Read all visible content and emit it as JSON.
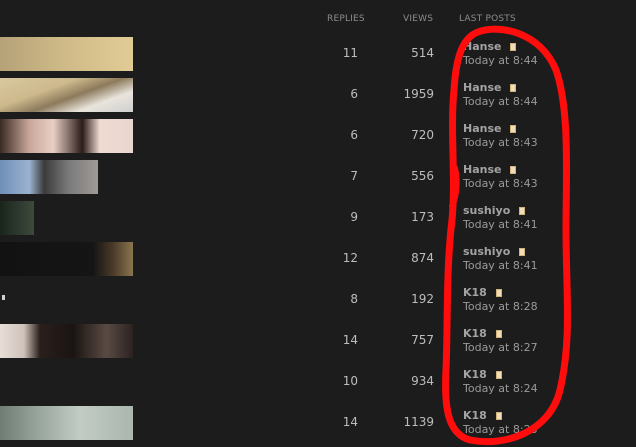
{
  "columns": {
    "replies": "REPLIES",
    "views": "VIEWS",
    "last_posts": "LAST POSTS"
  },
  "threads": [
    {
      "replies": "11",
      "views": "514",
      "user": "Hanse",
      "time": "Today at 8:44"
    },
    {
      "replies": "6",
      "views": "1959",
      "user": "Hanse",
      "time": "Today at 8:44"
    },
    {
      "replies": "6",
      "views": "720",
      "user": "Hanse",
      "time": "Today at 8:43"
    },
    {
      "replies": "7",
      "views": "556",
      "user": "Hanse",
      "time": "Today at 8:43"
    },
    {
      "replies": "9",
      "views": "173",
      "user": "sushiyo",
      "time": "Today at 8:41"
    },
    {
      "replies": "12",
      "views": "874",
      "user": "sushiyo",
      "time": "Today at 8:41"
    },
    {
      "replies": "8",
      "views": "192",
      "user": "K18",
      "time": "Today at 8:28"
    },
    {
      "replies": "14",
      "views": "757",
      "user": "K18",
      "time": "Today at 8:27"
    },
    {
      "replies": "10",
      "views": "934",
      "user": "K18",
      "time": "Today at 8:24"
    },
    {
      "replies": "14",
      "views": "1139",
      "user": "K18",
      "time": "Today at 8:23"
    }
  ],
  "colors": {
    "background": "#1c1c1c",
    "highlight": "#ff0d0d"
  }
}
